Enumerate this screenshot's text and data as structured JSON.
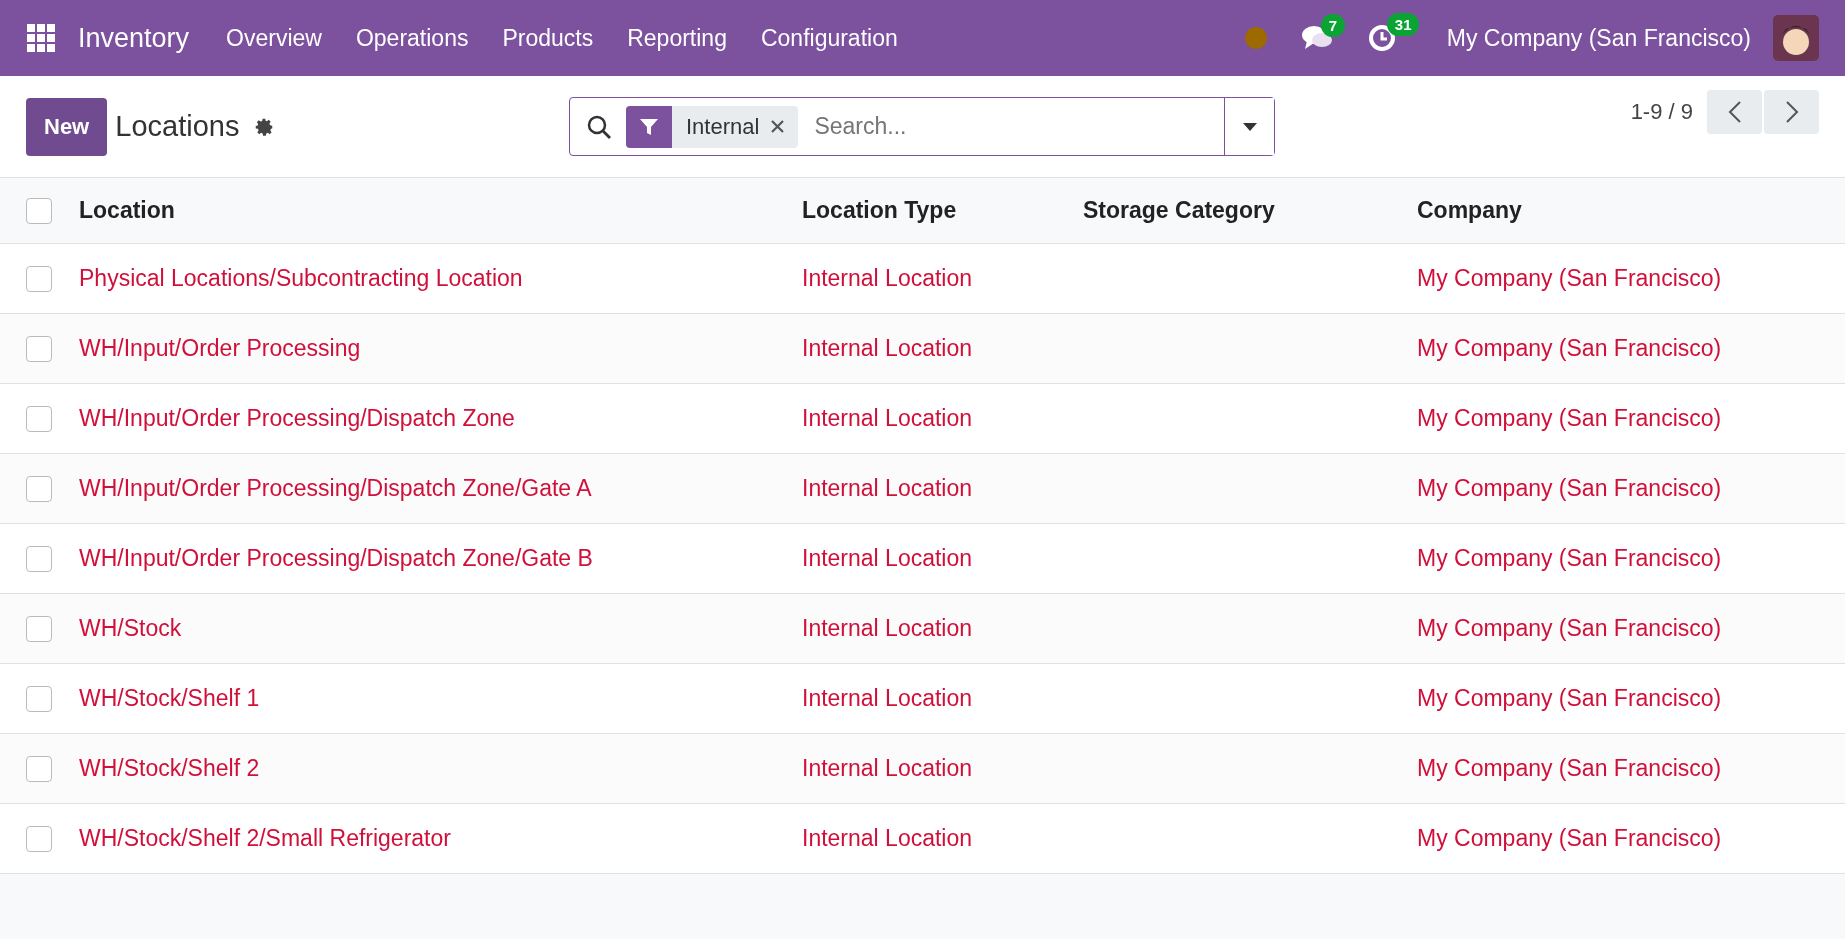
{
  "navbar": {
    "app_name": "Inventory",
    "menu": [
      "Overview",
      "Operations",
      "Products",
      "Reporting",
      "Configuration"
    ],
    "messages_count": "7",
    "activities_count": "31",
    "company": "My Company (San Francisco)"
  },
  "control_panel": {
    "new_button": "New",
    "title": "Locations",
    "search": {
      "facet": "Internal",
      "placeholder": "Search..."
    },
    "pager": "1-9 / 9"
  },
  "table": {
    "select_all_checked": false,
    "columns": [
      "Location",
      "Location Type",
      "Storage Category",
      "Company"
    ],
    "rows": [
      {
        "checked": false,
        "cells": [
          "Physical Locations/Subcontracting Location",
          "Internal Location",
          "",
          "My Company (San Francisco)"
        ]
      },
      {
        "checked": false,
        "cells": [
          "WH/Input/Order Processing",
          "Internal Location",
          "",
          "My Company (San Francisco)"
        ]
      },
      {
        "checked": false,
        "cells": [
          "WH/Input/Order Processing/Dispatch Zone",
          "Internal Location",
          "",
          "My Company (San Francisco)"
        ]
      },
      {
        "checked": false,
        "cells": [
          "WH/Input/Order Processing/Dispatch Zone/Gate A",
          "Internal Location",
          "",
          "My Company (San Francisco)"
        ]
      },
      {
        "checked": false,
        "cells": [
          "WH/Input/Order Processing/Dispatch Zone/Gate B",
          "Internal Location",
          "",
          "My Company (San Francisco)"
        ]
      },
      {
        "checked": false,
        "cells": [
          "WH/Stock",
          "Internal Location",
          "",
          "My Company (San Francisco)"
        ]
      },
      {
        "checked": false,
        "cells": [
          "WH/Stock/Shelf 1",
          "Internal Location",
          "",
          "My Company (San Francisco)"
        ]
      },
      {
        "checked": false,
        "cells": [
          "WH/Stock/Shelf 2",
          "Internal Location",
          "",
          "My Company (San Francisco)"
        ]
      },
      {
        "checked": false,
        "cells": [
          "WH/Stock/Shelf 2/Small Refrigerator",
          "Internal Location",
          "",
          "My Company (San Francisco)"
        ]
      }
    ]
  }
}
